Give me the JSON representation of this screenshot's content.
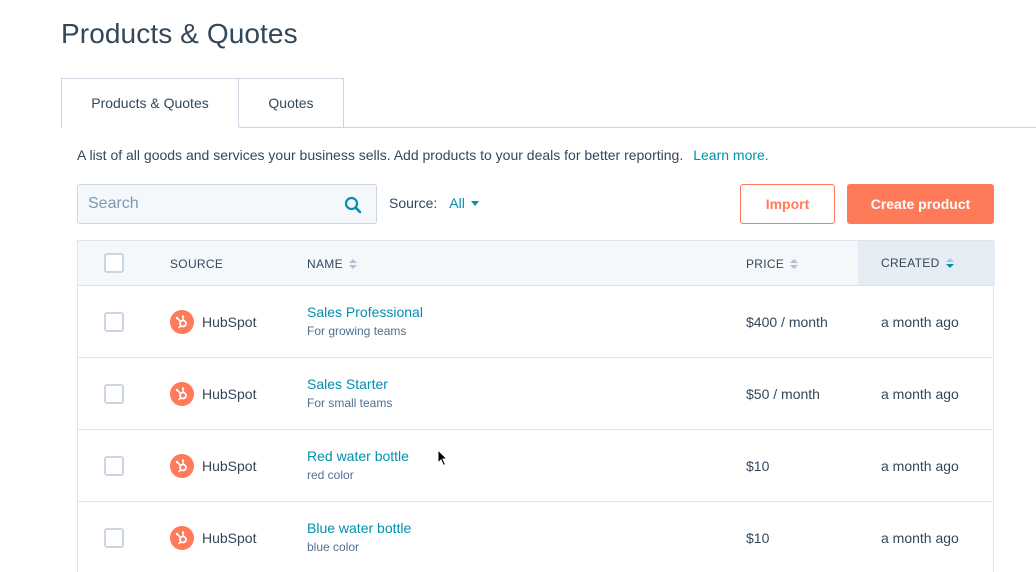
{
  "page_title": "Products & Quotes",
  "tabs": [
    {
      "label": "Products & Quotes",
      "active": true
    },
    {
      "label": "Quotes",
      "active": false
    }
  ],
  "description": {
    "text": "A list of all goods and services your business sells. Add products to your deals for better reporting.",
    "link": "Learn more."
  },
  "search": {
    "placeholder": "Search",
    "value": ""
  },
  "source_filter": {
    "label": "Source:",
    "value": "All"
  },
  "buttons": {
    "import": "Import",
    "create": "Create product"
  },
  "table": {
    "headers": {
      "source": "SOURCE",
      "name": "NAME",
      "price": "PRICE",
      "created": "CREATED"
    },
    "rows": [
      {
        "source": "HubSpot",
        "name": "Sales Professional",
        "description": "For growing teams",
        "price": "$400 / month",
        "created": "a month ago"
      },
      {
        "source": "HubSpot",
        "name": "Sales Starter",
        "description": "For small teams",
        "price": "$50 / month",
        "created": "a month ago"
      },
      {
        "source": "HubSpot",
        "name": "Red water bottle",
        "description": "red color",
        "price": "$10",
        "created": "a month ago"
      },
      {
        "source": "HubSpot",
        "name": "Blue water bottle",
        "description": "blue color",
        "price": "$10",
        "created": "a month ago"
      }
    ]
  },
  "colors": {
    "accent": "#ff7a59",
    "link": "#0091ae",
    "text": "#33475b"
  }
}
